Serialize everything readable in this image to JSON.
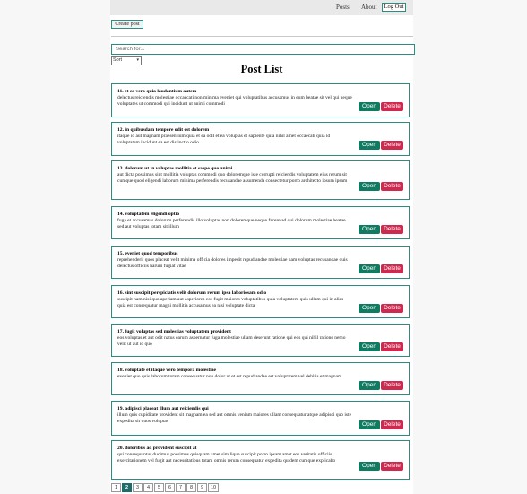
{
  "nav": {
    "links": [
      "Posts",
      "About"
    ],
    "logout_label": "Log Out"
  },
  "toolbar": {
    "create_label": "Create post"
  },
  "search": {
    "placeholder": "Search for..."
  },
  "sort": {
    "selected": "Sort"
  },
  "page_title": "Post List",
  "posts": [
    {
      "title": "11. et ea vero quia laudantium autem",
      "body": "delectus reiciendis molestiae occaecati non minima eveniet qui voluptatibus accusamus in eum beatae sit vel qui neque voluptates ut commodi qui incidunt ut animi commodi"
    },
    {
      "title": "12. in quibusdam tempore odit est dolorem",
      "body": "itaque id aut magnam praesentium quia et ea odit et ea voluptas et sapiente quia nihil amet occaecati quia id voluptatem incidunt ea est distinctio odio"
    },
    {
      "title": "13. dolorum ut in voluptas mollitia et saepe quo animi",
      "body": "aut dicta possimus sint mollitia voluptas commodi quo doloremque iste corrupti reiciendis voluptatem eius rerum sit cumque quod eligendi laborum minima perferendis recusandae assumenda consectetur porro architecto ipsum ipsam"
    },
    {
      "title": "14. voluptatem eligendi optio",
      "body": "fuga et accusamus dolorum perferendis illo voluptas non doloremque neque facere ad qui dolorum molestiae beatae sed aut voluptas totam sit illum"
    },
    {
      "title": "15. eveniet quod temporibus",
      "body": "reprehenderit quos placeat velit minima officia dolores impedit repudiandae molestiae nam voluptas recusandae quis delectus officiis harum fugiat vitae"
    },
    {
      "title": "16. sint suscipit perspiciatis velit dolorum rerum ipsa laboriosam odio",
      "body": "suscipit nam nisi quo aperiam aut asperiores eos fugit maiores voluptatibus quia voluptatem quis ullam qui in alias quia est consequatur magni mollitia accusamus ea nisi voluptate dicta"
    },
    {
      "title": "17. fugit voluptas sed molestias voluptatem provident",
      "body": "eos voluptas et aut odit natus earum aspernatur fuga molestiae ullam deserunt ratione qui eos qui nihil ratione nemo velit ut aut id quo"
    },
    {
      "title": "18. voluptate et itaque vero tempora molestiae",
      "body": "eveniet quo quis laborum totam consequatur non dolor ut et est repudiandae est voluptatem vel debitis et magnam"
    },
    {
      "title": "19. adipisci placeat illum aut reiciendis qui",
      "body": "illum quis cupiditate provident sit magnam ea sed aut omnis veniam maiores ullam consequatur atque adipisci quo iste expedita sit quos voluptas"
    },
    {
      "title": "20. doloribus ad provident suscipit at",
      "body": "qui consequuntur ducimus possimus quisquam amet similique suscipit porro ipsam amet eos veritatis officiis exercitationem vel fugit aut necessitatibus totam omnis rerum consequatur expedita quidem cumque explicabo"
    }
  ],
  "post_actions": {
    "open_label": "Open",
    "delete_label": "Delete"
  },
  "pagination": {
    "pages": [
      "1",
      "2",
      "3",
      "4",
      "5",
      "6",
      "7",
      "8",
      "9",
      "10"
    ],
    "current": "2"
  },
  "colors": {
    "accent": "#2a8c82",
    "open": "#0f7c62",
    "delete": "#d0294f"
  }
}
